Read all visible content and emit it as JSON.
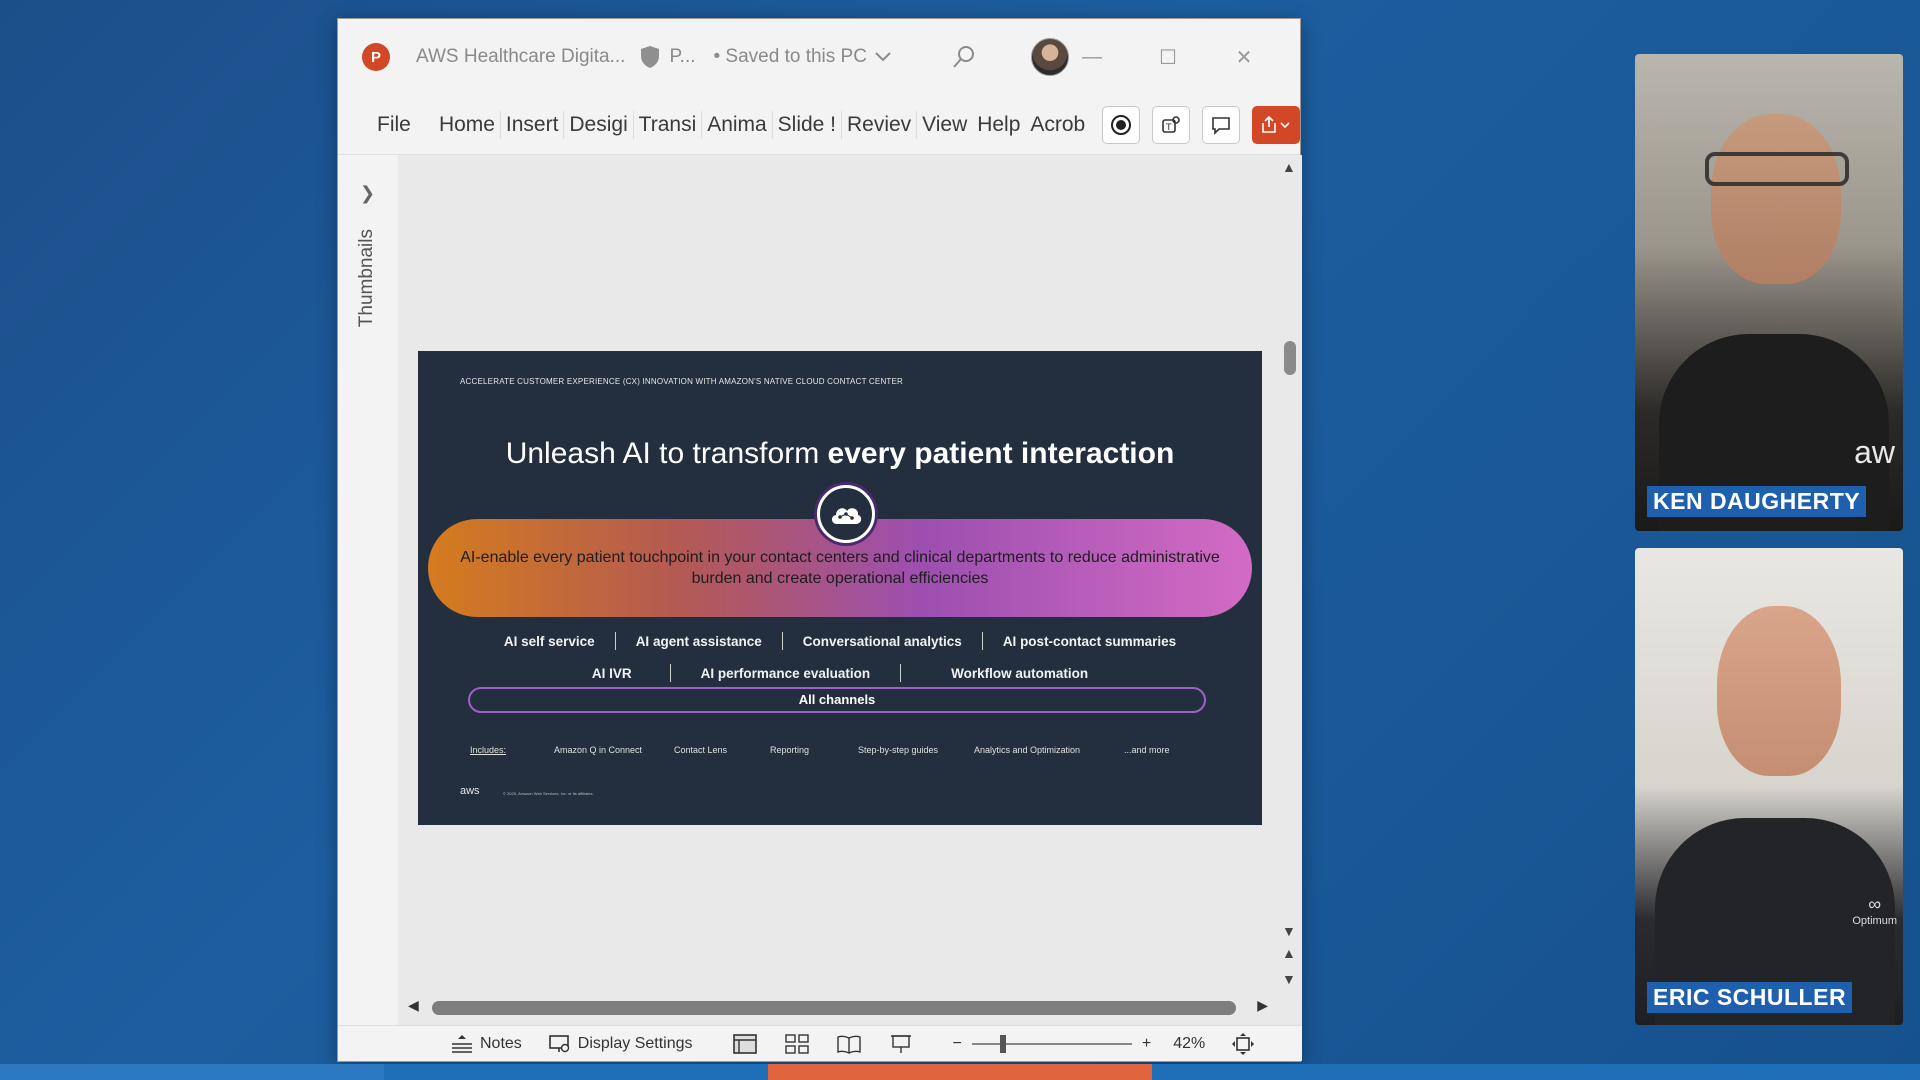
{
  "window": {
    "app_icon_letter": "P",
    "doc_title": "AWS Healthcare Digita...",
    "sensitivity_label": "P...",
    "saved_status": "• Saved to this PC"
  },
  "menu": {
    "items": [
      "File",
      "Home",
      "Insert",
      "Desigi",
      "Transi",
      "Anima",
      "Slide !",
      "Reviev",
      "View",
      "Help",
      "Acrob"
    ]
  },
  "thumbnails": {
    "label": "Thumbnails"
  },
  "slide": {
    "kicker": "ACCELERATE CUSTOMER EXPERIENCE (CX) INNOVATION WITH AMAZON'S NATIVE CLOUD CONTACT CENTER",
    "title_regular": "Unleash AI to transform ",
    "title_bold": "every patient interaction",
    "pill_text": "AI-enable every patient touchpoint in your contact centers and clinical departments to reduce administrative burden and create operational efficiencies",
    "capabilities_row1": [
      "AI self service",
      "AI agent assistance",
      "Conversational analytics",
      "AI post-contact summaries"
    ],
    "capabilities_row2": [
      "AI IVR",
      "AI performance evaluation",
      "Workflow automation"
    ],
    "channels": "All channels",
    "includes_label": "Includes:",
    "includes": [
      "Amazon Q in Connect",
      "Contact Lens",
      "Reporting",
      "Step-by-step guides",
      "Analytics and Optimization",
      "...and more"
    ],
    "footer_logo": "aws",
    "copyright": "© 2025, Amazon Web Services, Inc. or its affiliates."
  },
  "statusbar": {
    "notes": "Notes",
    "display_settings": "Display Settings",
    "zoom_level": "42%"
  },
  "participants": [
    {
      "name": "KEN DAUGHERTY",
      "logo": "aw"
    },
    {
      "name": "ERIC SCHULLER",
      "logo": "Optimum"
    }
  ],
  "colors": {
    "slide_bg": "#232f3e",
    "ppt_accent": "#d24726",
    "name_tag": "#1e5fae"
  }
}
